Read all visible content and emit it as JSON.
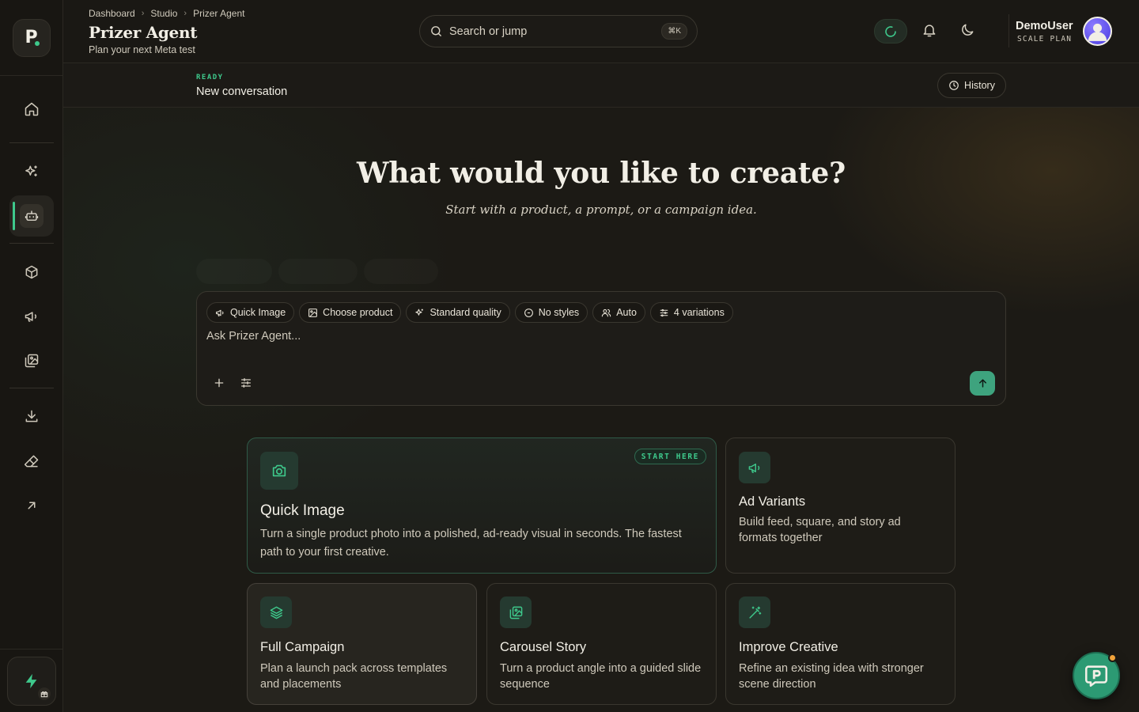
{
  "colors": {
    "accent": "#3ec98c",
    "background": "#1a1814",
    "send_button": "#3ea37e"
  },
  "sidebar": {
    "logo_letter": "P",
    "items": [
      {
        "name": "home",
        "icon": "home-icon"
      },
      {
        "name": "sparkles",
        "icon": "sparkles-icon"
      },
      {
        "name": "agent",
        "icon": "bot-icon",
        "active": true
      },
      {
        "name": "products",
        "icon": "box-icon"
      },
      {
        "name": "campaigns",
        "icon": "megaphone-icon"
      },
      {
        "name": "gallery",
        "icon": "images-icon"
      },
      {
        "name": "downloads",
        "icon": "download-icon"
      },
      {
        "name": "eraser",
        "icon": "eraser-icon"
      },
      {
        "name": "external",
        "icon": "arrow-up-right-icon"
      }
    ]
  },
  "header": {
    "breadcrumbs": [
      "Dashboard",
      "Studio",
      "Prizer Agent"
    ],
    "title": "Prizer Agent",
    "subtitle": "Plan your next Meta test",
    "search_placeholder": "Search or jump",
    "search_shortcut": "⌘K",
    "user_name": "DemoUser",
    "user_plan": "SCALE PLAN"
  },
  "conversation": {
    "status": "READY",
    "title": "New conversation",
    "history_label": "History"
  },
  "hero": {
    "title": "What would you like to create?",
    "subtitle": "Start with a product, a prompt, or a campaign idea."
  },
  "composer": {
    "chips": [
      {
        "label": "Quick Image",
        "icon": "megaphone-icon"
      },
      {
        "label": "Choose product",
        "icon": "image-icon"
      },
      {
        "label": "Standard quality",
        "icon": "sparkles-icon"
      },
      {
        "label": "No styles",
        "icon": "circle-slash-icon"
      },
      {
        "label": "Auto",
        "icon": "users-icon"
      },
      {
        "label": "4 variations",
        "icon": "sliders-icon"
      }
    ],
    "placeholder": "Ask Prizer Agent..."
  },
  "cards": [
    {
      "title": "Quick Image",
      "desc": "Turn a single product photo into a polished, ad-ready visual in seconds. The fastest path to your first creative.",
      "badge": "START HERE",
      "icon": "camera-icon"
    },
    {
      "title": "Ad Variants",
      "desc": "Build feed, square, and story ad formats together",
      "icon": "megaphone-icon"
    },
    {
      "title": "Full Campaign",
      "desc": "Plan a launch pack across templates and placements",
      "icon": "layers-icon"
    },
    {
      "title": "Carousel Story",
      "desc": "Turn a product angle into a guided slide sequence",
      "icon": "images-icon"
    },
    {
      "title": "Improve Creative",
      "desc": "Refine an existing idea with stronger scene direction",
      "icon": "wand-icon"
    }
  ]
}
